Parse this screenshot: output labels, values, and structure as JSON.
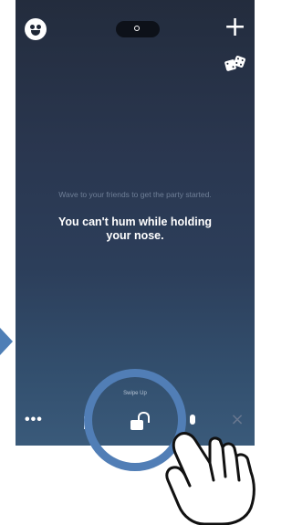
{
  "app": {
    "hint_text": "Wave to your friends to get the party started.",
    "joke_text": "You can't hum while holding your nose.",
    "swipe_label": "Swipe Up",
    "icons": [
      "emoji-icon",
      "camera-toggle-icon",
      "plus-icon",
      "dice-icon",
      "more-icon",
      "lock-icon",
      "microphone-icon",
      "close-icon",
      "arrow-icon",
      "hand-icon"
    ],
    "plus_glyph": "+",
    "more_glyph": "•••",
    "close_glyph": "×"
  },
  "colors": {
    "accent": "#517eb6",
    "screen_top": "#232c3d",
    "screen_bottom": "#3a5a7a"
  }
}
